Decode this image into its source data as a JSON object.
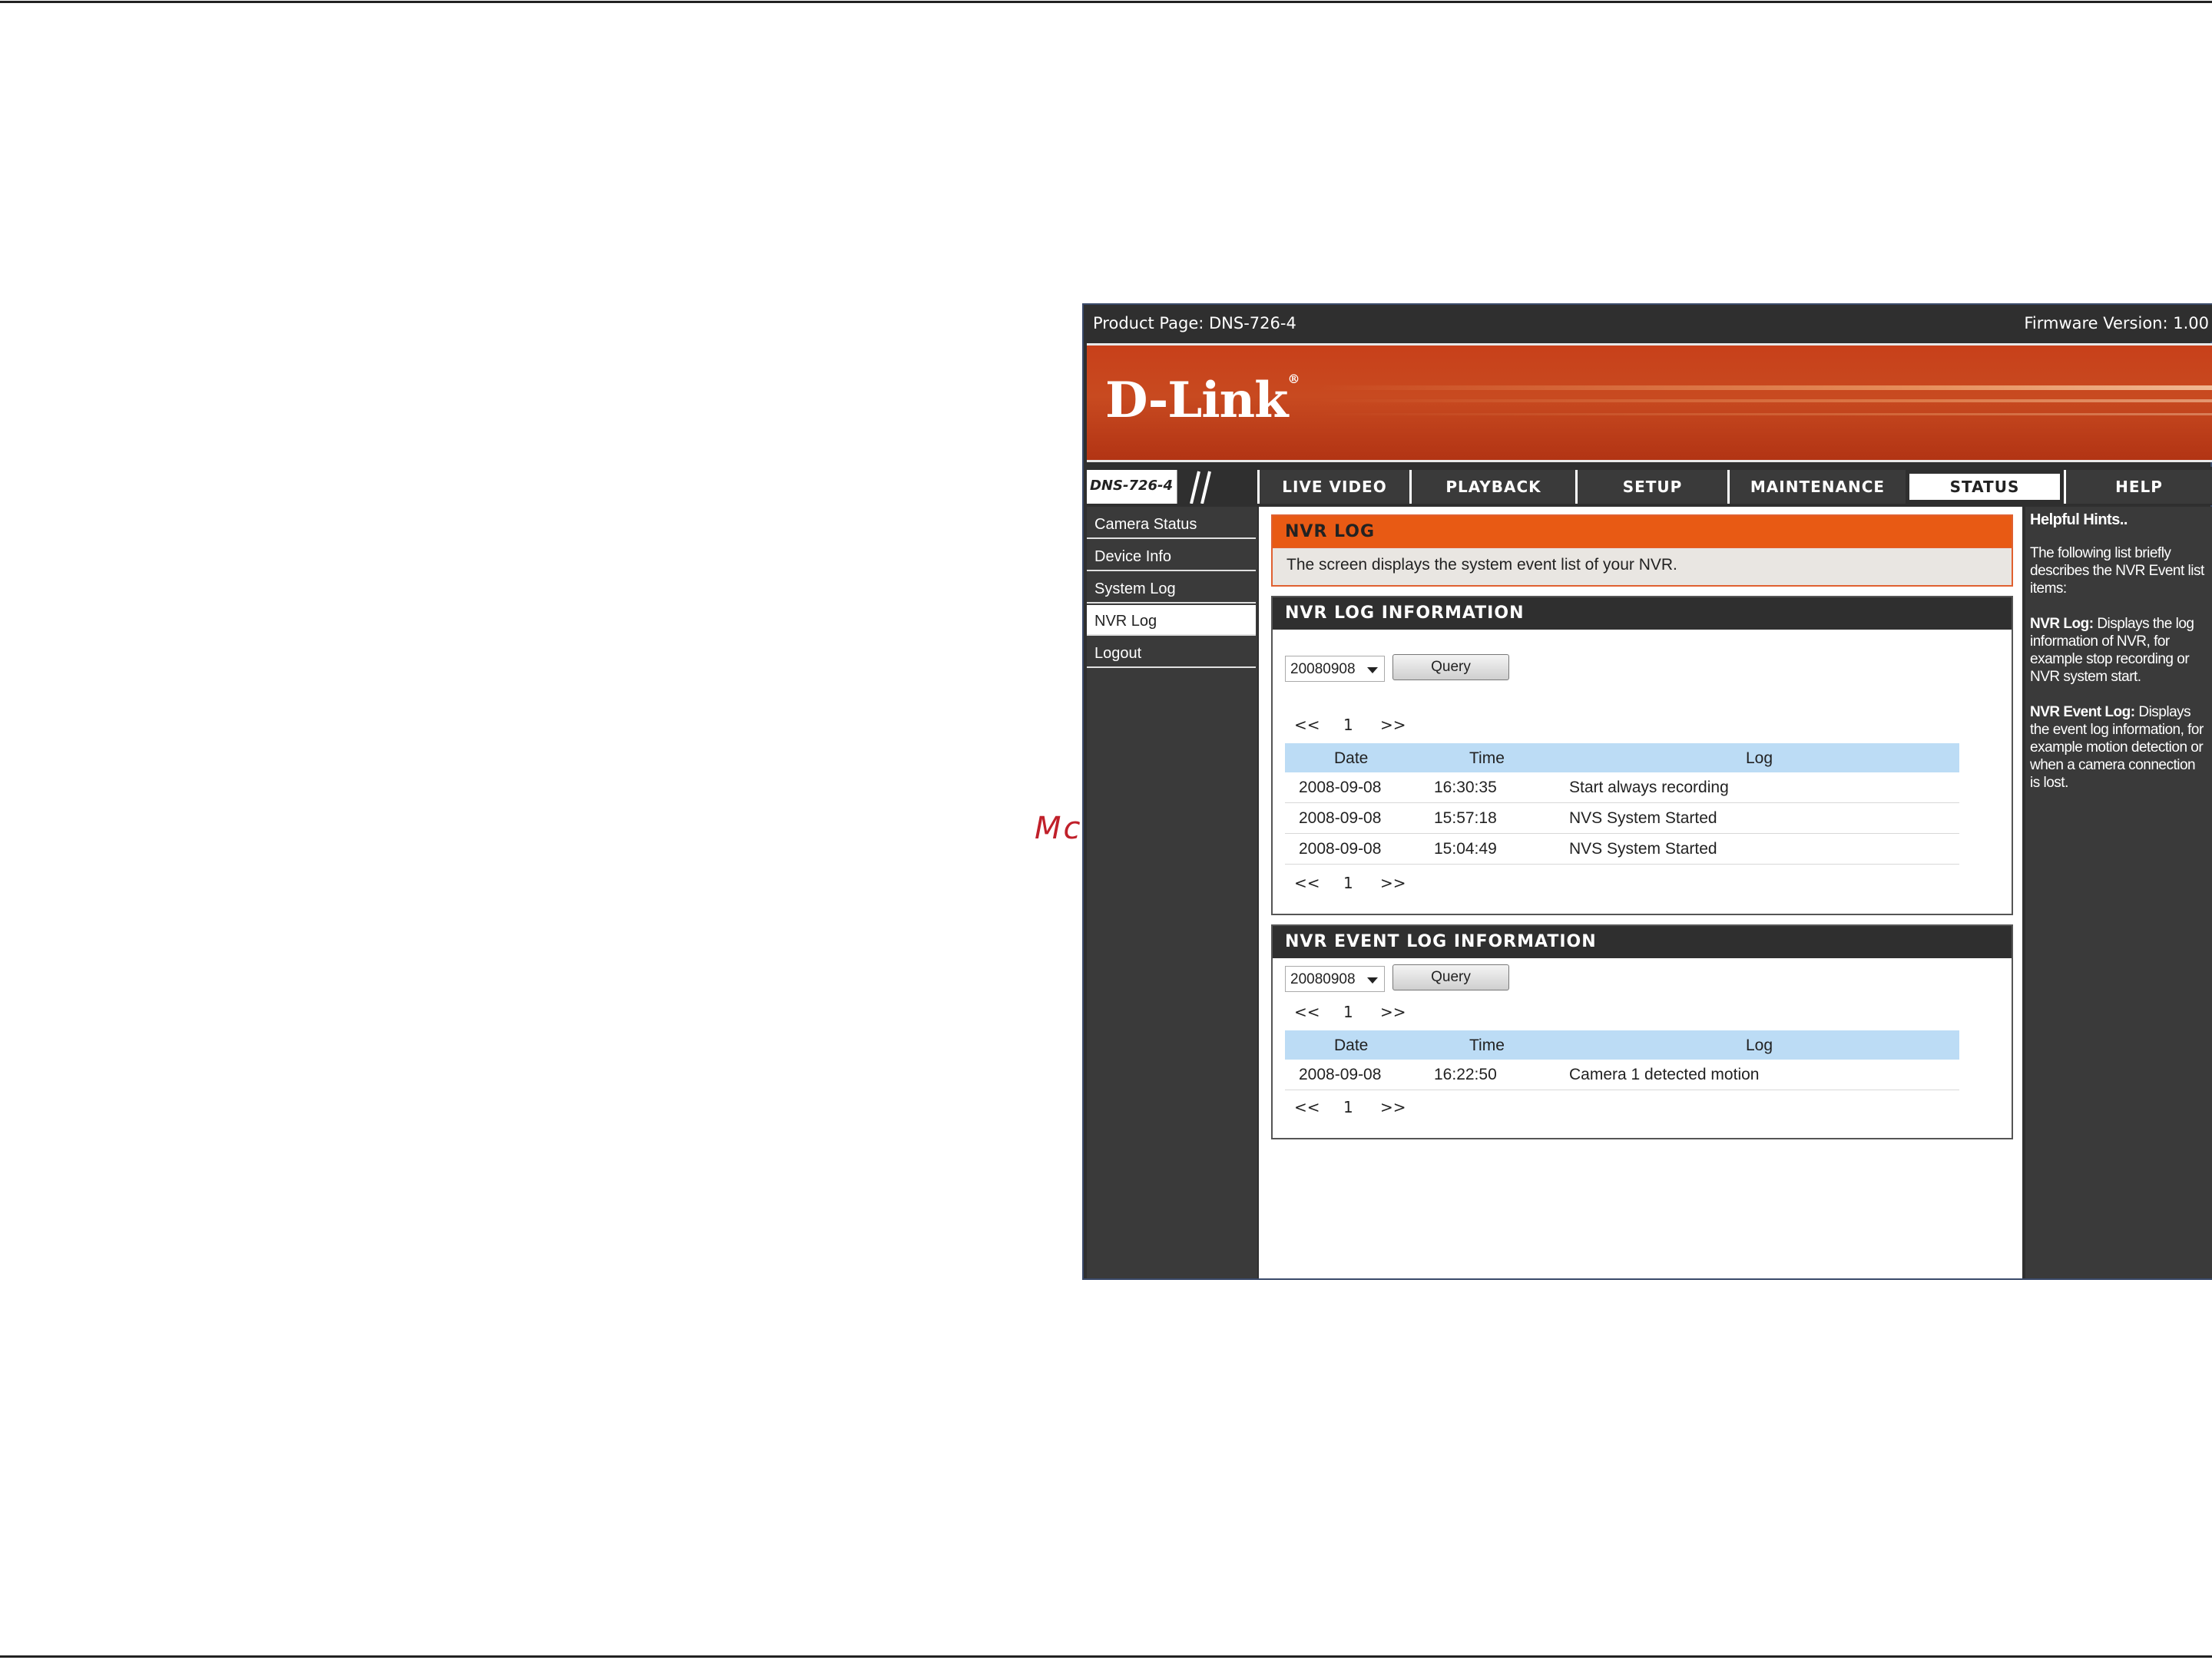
{
  "watermark": "McGrp.Ru",
  "topbar": {
    "product": "Product Page: DNS-726-4",
    "firmware": "Firmware Version: 1.00"
  },
  "banner": {
    "logo": "D-Link",
    "reg": "®"
  },
  "nav": {
    "model": "DNS-726-4",
    "tabs": [
      "LIVE VIDEO",
      "PLAYBACK",
      "SETUP",
      "MAINTENANCE",
      "STATUS",
      "HELP"
    ],
    "active_tab": "STATUS"
  },
  "sidebar": {
    "items": [
      "Camera Status",
      "Device Info",
      "System Log",
      "NVR Log",
      "Logout"
    ],
    "active": "NVR Log"
  },
  "nvr_log": {
    "title": "NVR LOG",
    "intro": "The screen displays the system event list of your NVR."
  },
  "log_info": {
    "title": "NVR LOG INFORMATION",
    "select_value": "20080908",
    "query_label": "Query",
    "pager": {
      "prev": "<<",
      "page": "1",
      "next": ">>"
    },
    "columns": [
      "Date",
      "Time",
      "Log"
    ],
    "rows": [
      {
        "date": "2008-09-08",
        "time": "16:30:35",
        "log": "Start always recording"
      },
      {
        "date": "2008-09-08",
        "time": "15:57:18",
        "log": "NVS System Started"
      },
      {
        "date": "2008-09-08",
        "time": "15:04:49",
        "log": "NVS System Started"
      }
    ]
  },
  "event_info": {
    "title": "NVR EVENT LOG INFORMATION",
    "select_value": "20080908",
    "query_label": "Query",
    "pager": {
      "prev": "<<",
      "page": "1",
      "next": ">>"
    },
    "columns": [
      "Date",
      "Time",
      "Log"
    ],
    "rows": [
      {
        "date": "2008-09-08",
        "time": "16:22:50",
        "log": "Camera 1 detected motion"
      }
    ]
  },
  "hints": {
    "title": "Helpful Hints..",
    "intro": "The following list briefly describes the NVR Event list items:",
    "items": [
      {
        "term": "NVR Log:",
        "text": "Displays the log information of NVR, for example stop recording or NVR system start."
      },
      {
        "term": "NVR Event Log:",
        "text": "Displays the event log information, for example motion detection or when a camera connection is lost."
      }
    ]
  },
  "colors": {
    "accent_orange": "#e85a14",
    "dark_bg": "#2f2f2f",
    "table_header": "#bcdcf5"
  }
}
